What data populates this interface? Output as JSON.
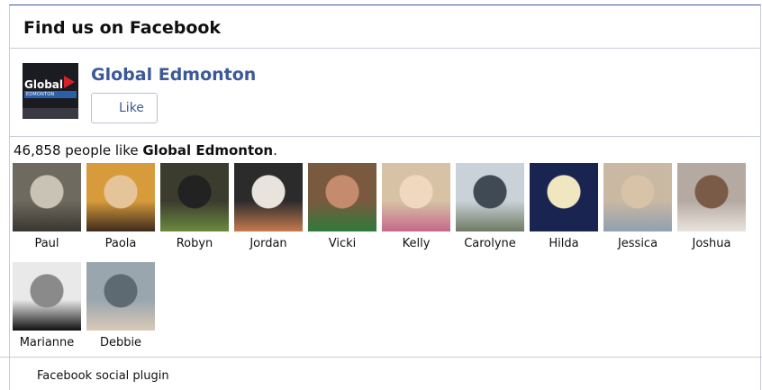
{
  "header": {
    "title": "Find us on Facebook"
  },
  "page": {
    "name": "Global Edmonton",
    "like_label": "Like",
    "logo_text": "Global",
    "logo_sub": "EDMONTON"
  },
  "likes": {
    "count": "46,858",
    "prefix": " people like ",
    "page_name": "Global Edmonton",
    "suffix": "."
  },
  "faces": [
    {
      "name": "Paul",
      "colors": [
        "#6f6a60",
        "#3a3630",
        "#c9c2b5"
      ]
    },
    {
      "name": "Paola",
      "colors": [
        "#d79b3b",
        "#3e2a1c",
        "#e6c49a"
      ]
    },
    {
      "name": "Robyn",
      "colors": [
        "#3b3b2e",
        "#6b8a3f",
        "#222"
      ]
    },
    {
      "name": "Jordan",
      "colors": [
        "#2b2b2b",
        "#c47a4e",
        "#e8e3dc"
      ]
    },
    {
      "name": "Vicki",
      "colors": [
        "#7a5a3f",
        "#2e7a3a",
        "#c58b6f"
      ]
    },
    {
      "name": "Kelly",
      "colors": [
        "#d7c2a6",
        "#c56a8a",
        "#f0d8c0"
      ]
    },
    {
      "name": "Carolyne",
      "colors": [
        "#c9d2d8",
        "#6f7a64",
        "#3f4a55"
      ]
    },
    {
      "name": "Hilda",
      "colors": [
        "#1a2450",
        "#1a2450",
        "#f0e6c0"
      ]
    },
    {
      "name": "Jessica",
      "colors": [
        "#c9b8a2",
        "#8fa1b0",
        "#d8c2a8"
      ]
    },
    {
      "name": "Joshua",
      "colors": [
        "#b5aaa2",
        "#e9e3dd",
        "#7a5b48"
      ]
    },
    {
      "name": "Marianne",
      "colors": [
        "#e9e9e9",
        "#111111",
        "#8a8a8a"
      ]
    },
    {
      "name": "Debbie",
      "colors": [
        "#9aa6ad",
        "#d9c9b8",
        "#5d6a72"
      ]
    }
  ],
  "footer": {
    "text": "Facebook social plugin"
  }
}
